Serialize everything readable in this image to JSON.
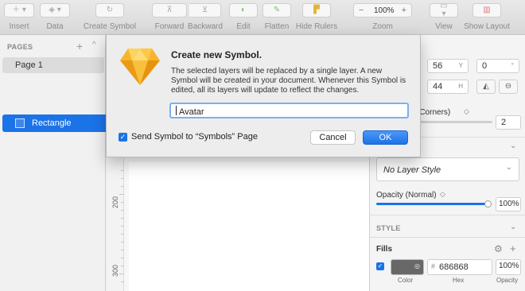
{
  "toolbar": {
    "items": [
      {
        "label": "Insert",
        "icon": "plus-icon"
      },
      {
        "label": "Data",
        "icon": "data-icon"
      },
      {
        "label": "Create Symbol",
        "icon": "symbol-icon"
      },
      {
        "label": "Forward",
        "icon": "forward-icon"
      },
      {
        "label": "Backward",
        "icon": "backward-icon"
      },
      {
        "label": "Edit",
        "icon": "edit-icon"
      },
      {
        "label": "Flatten",
        "icon": "flatten-icon"
      },
      {
        "label": "Hide Rulers",
        "icon": "ruler-icon"
      },
      {
        "label": "Zoom",
        "icon": "zoom-icon"
      },
      {
        "label": "View",
        "icon": "view-icon"
      },
      {
        "label": "Show Layout",
        "icon": "layout-icon"
      }
    ],
    "zoom_value": "100%",
    "zoom_minus": "−",
    "zoom_plus": "+"
  },
  "pages_panel": {
    "header": "PAGES",
    "add": "+",
    "collapse": "^",
    "pages": [
      "Page 1"
    ],
    "layers": [
      "Rectangle"
    ]
  },
  "ruler": {
    "labels": [
      "200",
      "300"
    ]
  },
  "inspector": {
    "y_value": "56",
    "y_suffix": "Y",
    "rotation_value": "0",
    "rotation_suffix": "°",
    "h_value": "44",
    "h_suffix": "H",
    "corners_label": "d Corners)",
    "corners_stepper": "◇",
    "corners_value": "2",
    "style_dropdown": "No Layer Style",
    "opacity_label": "Opacity (Normal)",
    "opacity_value": "100%",
    "style_header": "STYLE",
    "fills_label": "Fills",
    "fill_hash": "#",
    "fill_hex": "686868",
    "fill_opacity": "100%",
    "fill_color": "#686868",
    "fill_caption_color": "Color",
    "fill_caption_hex": "Hex",
    "fill_caption_opacity": "Opacity"
  },
  "dialog": {
    "title": "Create new Symbol.",
    "body": "The selected layers will be replaced by a single layer. A new Symbol will be created in your document. Whenever this Symbol is edited, all its layers will update to reflect the changes.",
    "input_value": "Avatar",
    "checkbox_label": "Send Symbol to “Symbols” Page",
    "checkbox_checked": true,
    "cancel_label": "Cancel",
    "ok_label": "OK"
  },
  "colors": {
    "accent": "#1b73e8",
    "logo_gold": "#f7b52b"
  }
}
